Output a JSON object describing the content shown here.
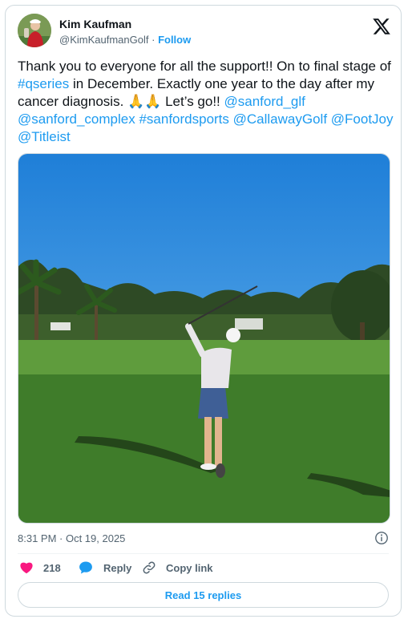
{
  "author": {
    "display_name": "Kim Kaufman",
    "handle": "@KimKaufmanGolf",
    "separator": "·",
    "follow_label": "Follow"
  },
  "tweet": {
    "segments": [
      {
        "text": "Thank you to everyone for all the support!! On to final stage of ",
        "type": "text"
      },
      {
        "text": "#qseries",
        "type": "link"
      },
      {
        "text": " in December. Exactly one year to the day after my cancer diagnosis. ",
        "type": "text"
      },
      {
        "text": "🙏🙏",
        "type": "text"
      },
      {
        "text": " Let’s go!! ",
        "type": "text"
      },
      {
        "text": "@sanford_glf",
        "type": "link"
      },
      {
        "text": " ",
        "type": "text"
      },
      {
        "text": "@sanford_complex",
        "type": "link"
      },
      {
        "text": " ",
        "type": "text"
      },
      {
        "text": "#sanfordsports",
        "type": "link"
      },
      {
        "text": " ",
        "type": "text"
      },
      {
        "text": "@CallawayGolf",
        "type": "link"
      },
      {
        "text": " ",
        "type": "text"
      },
      {
        "text": "@FootJoy",
        "type": "link"
      },
      {
        "text": " ",
        "type": "text"
      },
      {
        "text": "@Titleist",
        "type": "link"
      }
    ],
    "timestamp": "8:31 PM · Oct 19, 2025"
  },
  "actions": {
    "like_count": "218",
    "reply_label": "Reply",
    "copy_label": "Copy link",
    "read_replies_label": "Read 15 replies"
  },
  "icons": {
    "platform": "x-logo-icon",
    "like": "heart-icon",
    "reply": "speech-bubble-icon",
    "copy": "link-icon",
    "info": "info-icon"
  },
  "colors": {
    "accent": "#1d9bf0",
    "like": "#f91880",
    "text": "#0f1419",
    "muted": "#536471"
  }
}
